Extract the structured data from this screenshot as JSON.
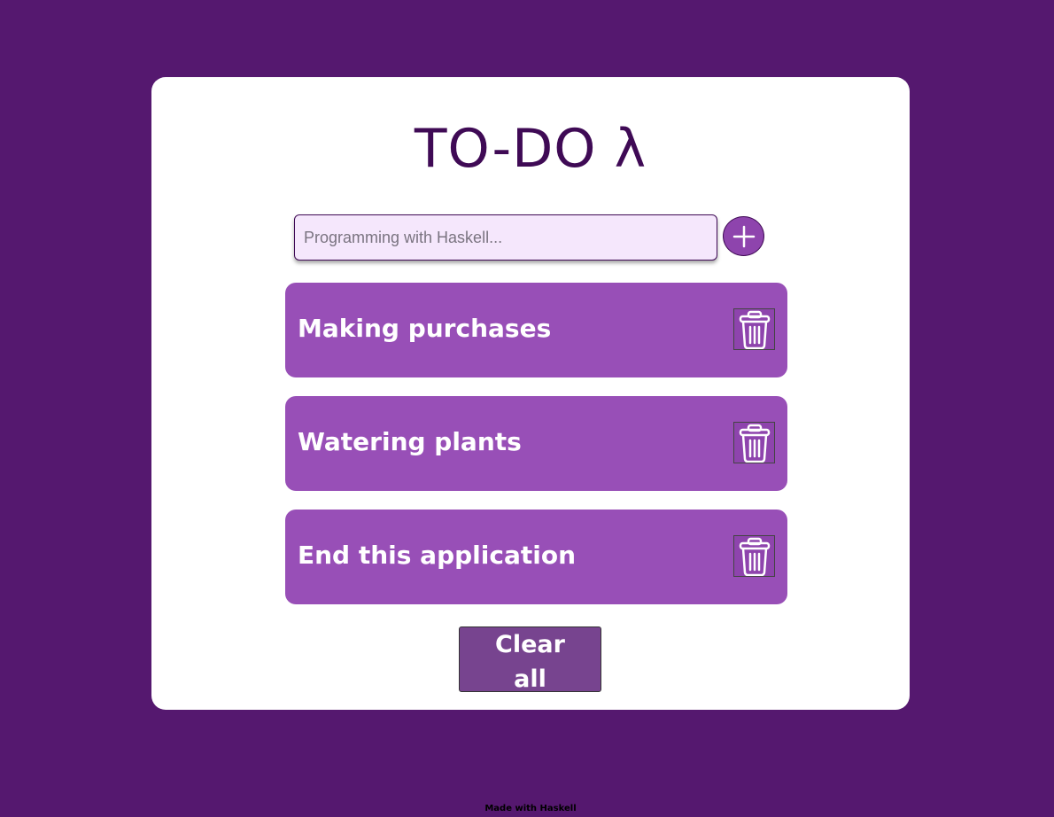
{
  "app": {
    "title": "TO-DO λ"
  },
  "input": {
    "placeholder": "Programming with Haskell...",
    "value": ""
  },
  "add_button": {
    "icon": "plus-icon"
  },
  "tasks": [
    {
      "label": "Making purchases",
      "delete_icon": "trash-icon"
    },
    {
      "label": "Watering plants",
      "delete_icon": "trash-icon"
    },
    {
      "label": "End this application",
      "delete_icon": "trash-icon"
    }
  ],
  "clear_button": {
    "label": "Clear all"
  },
  "footer": {
    "text": "Made with Haskell"
  },
  "colors": {
    "background": "#55186f",
    "card": "#ffffff",
    "title": "#3f0a55",
    "task": "#984fb7",
    "input_bg": "#f5e7fc",
    "clear_button": "#77448f"
  }
}
